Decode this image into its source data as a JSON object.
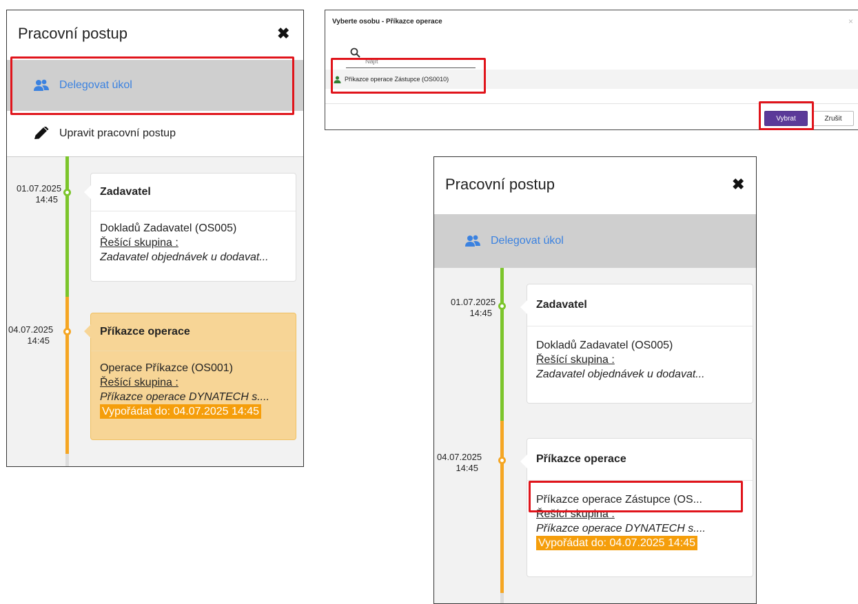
{
  "left_panel": {
    "title": "Pracovní postup",
    "menu": {
      "delegate_label": "Delegovat úkol",
      "edit_label": "Upravit pracovní postup"
    },
    "timeline": [
      {
        "date": "01.07.2025",
        "time": "14:45",
        "title": "Zadavatel",
        "person": "Dokladů Zadavatel (OS005)",
        "group_label": "Řešící skupina :",
        "group_value": "Zadavatel objednávek u dodavat...",
        "status_color": "#7cc52b"
      },
      {
        "date": "04.07.2025",
        "time": "14:45",
        "title": "Příkazce operace",
        "person": "Operace Příkazce (OS001)",
        "group_label": "Řešící skupina :",
        "group_value": "Příkazce operace DYNATECH s....",
        "deadline": "Vypořádat do: 04.07.2025 14:45",
        "status_color": "#f5a623"
      }
    ]
  },
  "dialog": {
    "title": "Vyberte osobu - Příkazce operace",
    "close_glyph": "×",
    "search_placeholder": "Najít",
    "result": "Příkazce operace Zástupce (OS0010)",
    "select_label": "Vybrat",
    "cancel_label": "Zrušit"
  },
  "right_panel": {
    "title": "Pracovní postup",
    "menu": {
      "delegate_label": "Delegovat úkol"
    },
    "timeline": [
      {
        "date": "01.07.2025",
        "time": "14:45",
        "title": "Zadavatel",
        "person": "Dokladů Zadavatel (OS005)",
        "group_label": "Řešící skupina :",
        "group_value": "Zadavatel objednávek u dodavat...",
        "status_color": "#7cc52b"
      },
      {
        "date": "04.07.2025",
        "time": "14:45",
        "title": "Příkazce operace",
        "person": "Příkazce operace Zástupce (OS...",
        "group_label": "Řešící skupina :",
        "group_value": "Příkazce operace DYNATECH s....",
        "deadline": "Vypořádat do: 04.07.2025 14:45",
        "status_color": "#f5a623"
      }
    ]
  },
  "close_glyph": "✖",
  "colors": {
    "accent_blue": "#3b82e0",
    "highlight_red": "#e0141b",
    "primary_button": "#5b3a99",
    "deadline_orange": "#f59e0b",
    "active_card": "#f7d596"
  }
}
